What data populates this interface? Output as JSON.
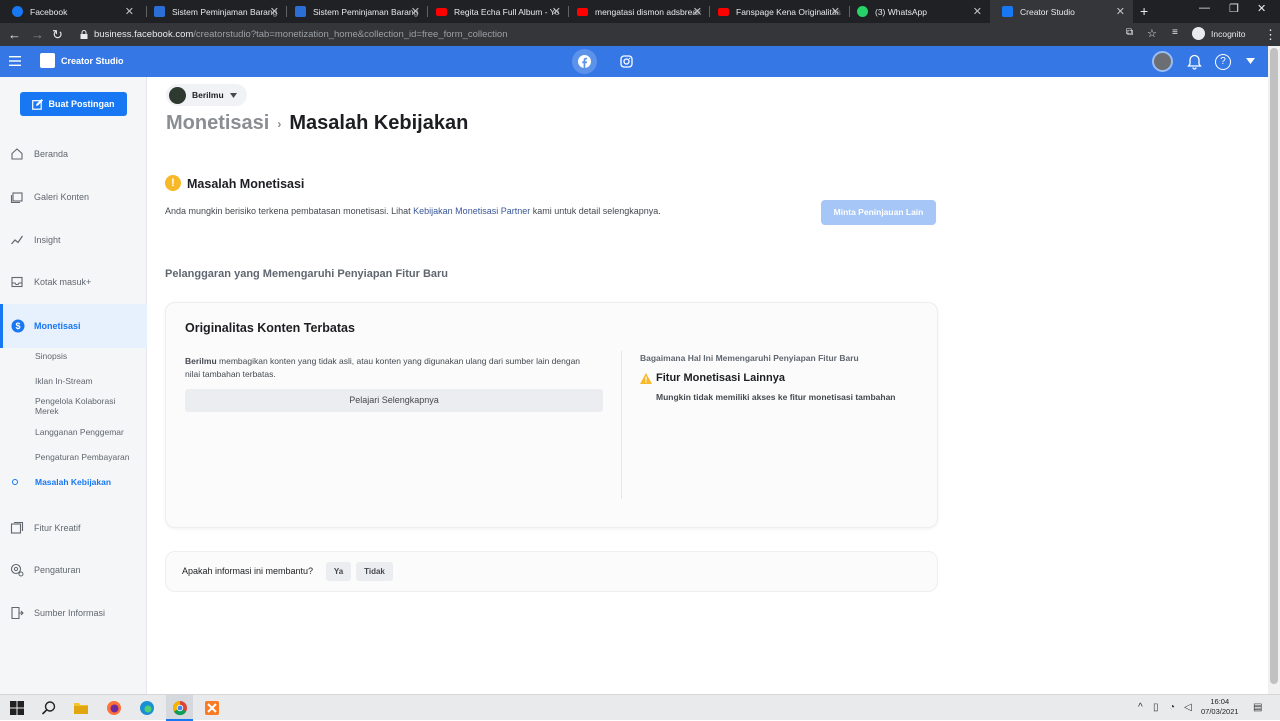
{
  "browser": {
    "tabs": [
      {
        "title": "Facebook",
        "favicon": "facebook-icon",
        "color": "#1877f2"
      },
      {
        "title": "Sistem Peminjaman Barang",
        "favicon": "powershell-icon",
        "color": "#2a6fd6"
      },
      {
        "title": "Sistem Peminjaman Barang",
        "favicon": "powershell-icon",
        "color": "#2a6fd6"
      },
      {
        "title": "Regita Echa Full Album - Yo",
        "favicon": "youtube-icon",
        "color": "#ff0000"
      },
      {
        "title": "mengatasi dismon adsbreak",
        "favicon": "youtube-icon",
        "color": "#ff0000"
      },
      {
        "title": "Fanspage Kena Originalitas",
        "favicon": "youtube-icon",
        "color": "#ff0000"
      },
      {
        "title": "(3) WhatsApp",
        "favicon": "whatsapp-icon",
        "color": "#25d366"
      },
      {
        "title": "Creator Studio",
        "favicon": "creator-studio-icon",
        "color": "#1877f2",
        "active": true
      }
    ],
    "url_host": "business.facebook.com",
    "url_path": "/creatorstudio?tab=monetization_home&collection_id=free_form_collection",
    "incognito_label": "Incognito"
  },
  "topbar": {
    "title": "Creator Studio",
    "accent": "#3578e5"
  },
  "sidebar": {
    "create_button": "Buat Postingan",
    "items": [
      {
        "label": "Beranda",
        "icon": "home-icon"
      },
      {
        "label": "Galeri Konten",
        "icon": "gallery-icon"
      },
      {
        "label": "Insight",
        "icon": "chart-icon"
      },
      {
        "label": "Kotak masuk+",
        "icon": "inbox-icon"
      },
      {
        "label": "Monetisasi",
        "icon": "dollar-icon"
      },
      {
        "label": "Fitur Kreatif",
        "icon": "creative-icon"
      },
      {
        "label": "Pengaturan",
        "icon": "settings-icon"
      },
      {
        "label": "Sumber Informasi",
        "icon": "resources-icon"
      }
    ],
    "subitems": [
      "Sinopsis",
      "Iklan In-Stream",
      "Pengelola Kolaborasi Merek",
      "Langganan Penggemar",
      "Pengaturan Pembayaran",
      "Masalah Kebijakan"
    ]
  },
  "main": {
    "account_name": "Berilmu",
    "breadcrumb": {
      "parent": "Monetisasi",
      "current": "Masalah Kebijakan"
    },
    "issue_title": "Masalah Monetisasi",
    "issue_text_pre": "Anda mungkin berisiko terkena pembatasan monetisasi. Lihat ",
    "issue_link": "Kebijakan Monetisasi Partner",
    "issue_text_post": " kami untuk detail selengkapnya.",
    "request_button": "Minta Peninjauan Lain",
    "section_title": "Pelanggaran yang Memengaruhi Penyiapan Fitur Baru",
    "card": {
      "title": "Originalitas Konten Terbatas",
      "text_bold": "Berilmu",
      "text": " membagikan konten yang tidak asli, atau konten yang digunakan ulang dari sumber lain dengan nilai tambahan terbatas.",
      "learn_button": "Pelajari Selengkapnya",
      "impact_heading": "Bagaimana Hal Ini Memengaruhi Penyiapan Fitur Baru",
      "impact_title": "Fitur Monetisasi Lainnya",
      "impact_text": "Mungkin tidak memiliki akses ke fitur monetisasi tambahan"
    },
    "feedback": {
      "question": "Apakah informasi ini membantu?",
      "yes": "Ya",
      "no": "Tidak"
    }
  },
  "taskbar": {
    "time": "16:04",
    "date": "07/03/2021"
  }
}
